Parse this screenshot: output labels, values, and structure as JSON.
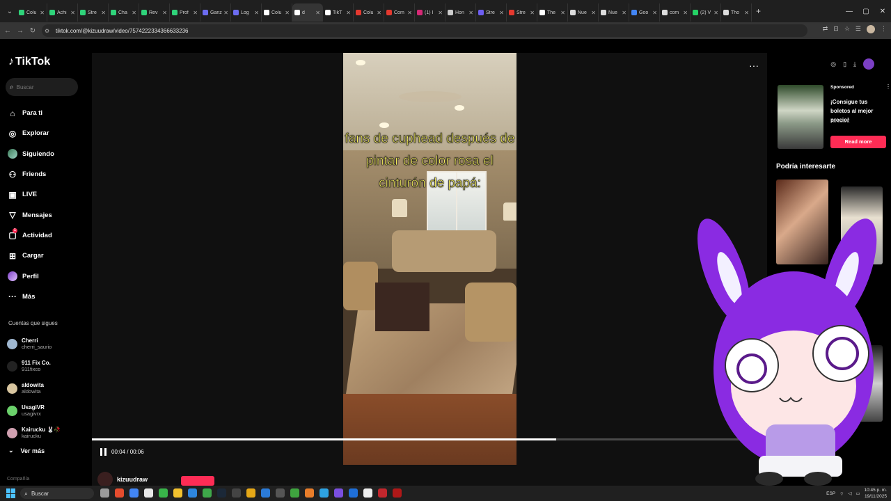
{
  "browser": {
    "tabs": [
      {
        "label": "Colu",
        "color": "#2fd37a"
      },
      {
        "label": "Achi",
        "color": "#2fd37a"
      },
      {
        "label": "Stre",
        "color": "#2fd37a"
      },
      {
        "label": "Cha",
        "color": "#2fd37a"
      },
      {
        "label": "Rev",
        "color": "#2fd37a"
      },
      {
        "label": "Prof",
        "color": "#2fd37a"
      },
      {
        "label": "Ganz",
        "color": "#6c6cf0"
      },
      {
        "label": "Log",
        "color": "#6c6cf0"
      },
      {
        "label": "Colu",
        "color": "#ffffff"
      },
      {
        "label": "d",
        "color": "#ffffff",
        "active": true
      },
      {
        "label": "TikT",
        "color": "#ffffff"
      },
      {
        "label": "Colu",
        "color": "#e5392f"
      },
      {
        "label": "Com",
        "color": "#e5392f"
      },
      {
        "label": "(1) I",
        "color": "#d62976"
      },
      {
        "label": "Hon",
        "color": "#cccccc"
      },
      {
        "label": "Stre",
        "color": "#6d5ef0"
      },
      {
        "label": "Stre",
        "color": "#e5392f"
      },
      {
        "label": "The",
        "color": "#ffffff"
      },
      {
        "label": "Nue",
        "color": "#dddddd"
      },
      {
        "label": "Nue",
        "color": "#dddddd"
      },
      {
        "label": "Goo",
        "color": "#4285f4"
      },
      {
        "label": "com",
        "color": "#dddddd"
      },
      {
        "label": "(2) V",
        "color": "#25d366"
      },
      {
        "label": "Tho",
        "color": "#dddddd"
      }
    ],
    "url": "tiktok.com/@kizuudraw/video/7574222334366633236"
  },
  "tiktok": {
    "brand": "TikTok",
    "search_placeholder": "Buscar",
    "nav": [
      {
        "label": "Para ti",
        "icon": "home-icon",
        "glyph": "⌂"
      },
      {
        "label": "Explorar",
        "icon": "compass-icon",
        "glyph": "◎"
      },
      {
        "label": "Siguiendo",
        "icon": "following-avatar",
        "glyph": ""
      },
      {
        "label": "Friends",
        "icon": "friends-icon",
        "glyph": "⚇"
      },
      {
        "label": "LIVE",
        "icon": "live-icon",
        "glyph": "▣"
      },
      {
        "label": "Mensajes",
        "icon": "messages-icon",
        "glyph": "▽"
      },
      {
        "label": "Actividad",
        "icon": "activity-icon",
        "glyph": "▢",
        "badge": "1"
      },
      {
        "label": "Cargar",
        "icon": "upload-icon",
        "glyph": "⊞"
      },
      {
        "label": "Perfil",
        "icon": "profile-avatar",
        "glyph": "◉"
      },
      {
        "label": "Más",
        "icon": "more-icon",
        "glyph": "···"
      }
    ],
    "following_title": "Cuentas que sigues",
    "following": [
      {
        "name": "Cherri",
        "user": "cherri_saurio",
        "color": "#9fb7d0"
      },
      {
        "name": "911 Fix Co.",
        "user": "911fixco",
        "color": "#222222"
      },
      {
        "name": "aldowita",
        "user": "aldowita",
        "color": "#d8c6a0"
      },
      {
        "name": "UsagiVR",
        "user": "usagivrx",
        "color": "#6bd16b"
      },
      {
        "name": "Kairucku 🐰🥀",
        "user": "kairucku",
        "color": "#d0a0b0"
      }
    ],
    "see_more": "Ver más",
    "company": "Compañía"
  },
  "video": {
    "caption": "fans de cuphead después de pintar de color rosa el cinturón de papá:",
    "time": "00:04 / 00:06",
    "progress": 0.688,
    "author": "kizuudraw"
  },
  "sidebar_right": {
    "sponsored": "Sponsored",
    "ad_title": "¡Consigue tus boletos al mejor precio!",
    "ad_brand": "Formula E",
    "ad_button": "Read more",
    "interest_title": "Podría interesarte"
  },
  "taskbar": {
    "search_placeholder": "Buscar",
    "lang": "ESP",
    "time": "10:45 p. m.",
    "date": "19/11/2025"
  }
}
